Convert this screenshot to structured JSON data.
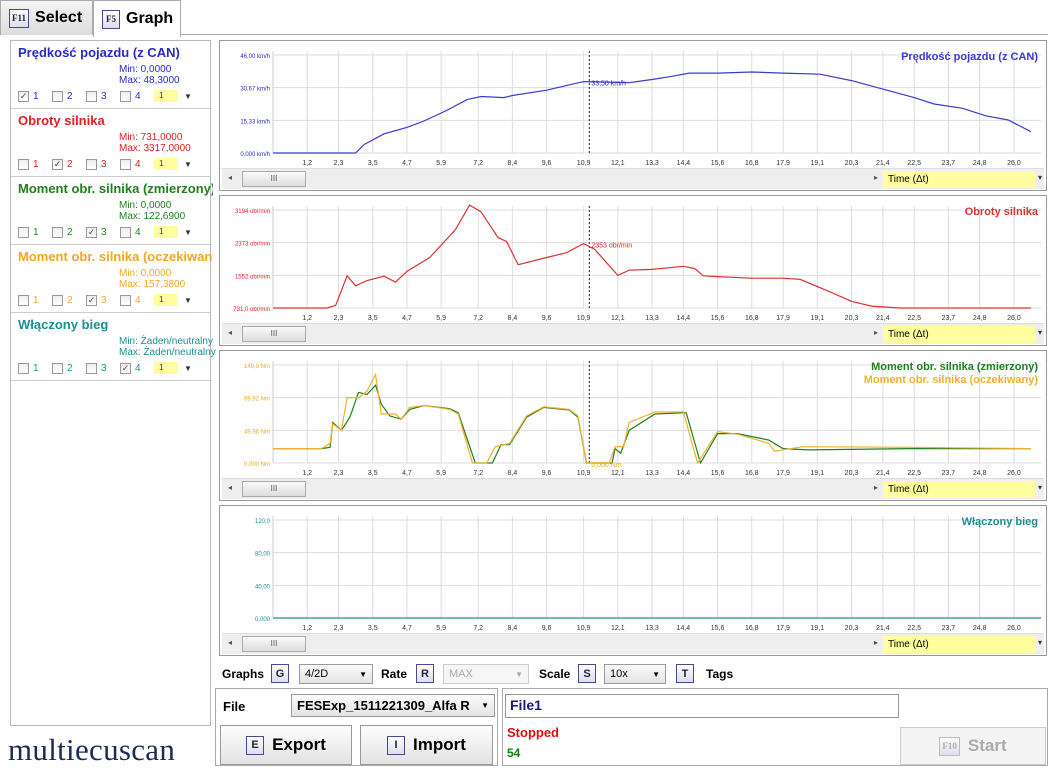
{
  "tabs": [
    {
      "key": "F11",
      "label": "Select"
    },
    {
      "key": "F5",
      "label": "Graph"
    }
  ],
  "parameters": [
    {
      "title": "Prędkość pojazdu (z CAN)",
      "min": "Min: 0,0000",
      "max": "Max: 48,3000",
      "color": "#2a2ac8",
      "checked": 1,
      "scale": "1"
    },
    {
      "title": "Obroty silnika",
      "min": "Min: 731,0000",
      "max": "Max: 3317,0000",
      "color": "#e02020",
      "checked": 2,
      "scale": "1"
    },
    {
      "title": "Moment obr. silnika (zmierzony)",
      "min": "Min: 0,0000",
      "max": "Max: 122,6900",
      "color": "#208020",
      "checked": 3,
      "scale": "1"
    },
    {
      "title": "Moment obr. silnika (oczekiwany)",
      "min": "Min: 0,0000",
      "max": "Max: 157,3800",
      "color": "#f0a820",
      "checked": 3,
      "scale": "1"
    },
    {
      "title": "Włączony bieg",
      "min": "Min: Żaden/neutralny",
      "max": "Max: Żaden/neutralny",
      "color": "#1a9090",
      "checked": 4,
      "scale": "1"
    }
  ],
  "checkbox_labels": [
    "1",
    "2",
    "3",
    "4"
  ],
  "logo": "multiecuscan",
  "axis": {
    "label": "Time (Δt)",
    "scroll_thumb": "III",
    "ticks": [
      1.2,
      2.3,
      3.5,
      4.7,
      5.9,
      7.2,
      8.4,
      9.6,
      10.9,
      12.1,
      13.3,
      14.4,
      15.6,
      16.8,
      17.9,
      19.1,
      20.3,
      21.4,
      22.5,
      23.7,
      24.8,
      26.0
    ],
    "tick_labels": [
      "1,2",
      "2,3",
      "3,5",
      "4,7",
      "5,9",
      "7,2",
      "8,4",
      "9,6",
      "10,9",
      "12,1",
      "13,3",
      "14,4",
      "15,6",
      "16,8",
      "17,9",
      "19,1",
      "20,3",
      "21,4",
      "22,5",
      "23,7",
      "24,8",
      "26,0"
    ],
    "xlim": [
      0,
      26.95
    ],
    "cursor_t": 11.1
  },
  "chart_data": [
    {
      "type": "line",
      "ylim": [
        0,
        46
      ],
      "ytick_labels": [
        "46,00 km/h",
        "30,67 km/h",
        "15,33 km/h",
        "0,000 km/h"
      ],
      "yticks": [
        46,
        30.67,
        15.33,
        0
      ],
      "cursor_label": "33,50 km/h",
      "cursor_color": "#2a2ac8",
      "series": [
        {
          "name": "Prędkość pojazdu (z CAN)",
          "color": "#3a3ad0",
          "points": [
            [
              0,
              0
            ],
            [
              2.9,
              0
            ],
            [
              3.2,
              4
            ],
            [
              3.9,
              9
            ],
            [
              4.7,
              12
            ],
            [
              5.3,
              15
            ],
            [
              6.1,
              20
            ],
            [
              6.8,
              25
            ],
            [
              7.3,
              26.5
            ],
            [
              8.1,
              26
            ],
            [
              8.4,
              27
            ],
            [
              9.6,
              29.5
            ],
            [
              10.9,
              33.5
            ],
            [
              11.8,
              33.3
            ],
            [
              12.5,
              33
            ],
            [
              13.3,
              34.5
            ],
            [
              14,
              36
            ],
            [
              14.6,
              37.5
            ],
            [
              15.6,
              37.5
            ],
            [
              16.8,
              38
            ],
            [
              17.9,
              37.5
            ],
            [
              19.2,
              37
            ],
            [
              20.3,
              34
            ],
            [
              21.4,
              30
            ],
            [
              22.5,
              26
            ],
            [
              23.2,
              23
            ],
            [
              24.2,
              21
            ],
            [
              25,
              17.5
            ],
            [
              25.8,
              15.5
            ],
            [
              26.6,
              10
            ]
          ]
        }
      ]
    },
    {
      "type": "line",
      "ylim": [
        731,
        3194
      ],
      "ytick_labels": [
        "3194 obr/min",
        "2373 obr/min",
        "1552 obr/min",
        "731,0 obr/min"
      ],
      "yticks": [
        3194,
        2373,
        1552,
        731
      ],
      "cursor_label": "2353 obr/min",
      "cursor_color": "#e02020",
      "series": [
        {
          "name": "Obroty silnika",
          "color": "#e03030",
          "points": [
            [
              0,
              731
            ],
            [
              1.9,
              731
            ],
            [
              2.2,
              800
            ],
            [
              2.6,
              1540
            ],
            [
              2.9,
              1290
            ],
            [
              3.3,
              1420
            ],
            [
              3.9,
              1530
            ],
            [
              4.3,
              1380
            ],
            [
              4.7,
              1650
            ],
            [
              5.5,
              2000
            ],
            [
              6.4,
              2700
            ],
            [
              6.9,
              3317
            ],
            [
              7.3,
              3150
            ],
            [
              7.9,
              2500
            ],
            [
              8.2,
              2400
            ],
            [
              8.6,
              1820
            ],
            [
              9.6,
              2000
            ],
            [
              10.3,
              2120
            ],
            [
              10.9,
              2353
            ],
            [
              11.3,
              2200
            ],
            [
              12.1,
              1550
            ],
            [
              12.5,
              1680
            ],
            [
              13.3,
              1700
            ],
            [
              14.4,
              1780
            ],
            [
              14.8,
              1720
            ],
            [
              15.1,
              1540
            ],
            [
              15.6,
              1520
            ],
            [
              16.8,
              1480
            ],
            [
              17.9,
              1480
            ],
            [
              18.5,
              1450
            ],
            [
              19.5,
              1150
            ],
            [
              20.3,
              900
            ],
            [
              21,
              780
            ],
            [
              22,
              731
            ],
            [
              26.6,
              731
            ]
          ]
        }
      ]
    },
    {
      "type": "line",
      "ylim": [
        0,
        149.9
      ],
      "ytick_labels": [
        "149,9 Nm",
        "99,92 Nm",
        "49,96 Nm",
        "0,000 Nm"
      ],
      "yticks": [
        149.9,
        99.92,
        49.96,
        0
      ],
      "cursor_label": "0,000 Nm",
      "cursor_color": "#f0a820",
      "series": [
        {
          "name": "Moment obr. silnika (zmierzony)",
          "color": "#208020",
          "points": [
            [
              0,
              22
            ],
            [
              1.7,
              22
            ],
            [
              2.0,
              24
            ],
            [
              2.1,
              62
            ],
            [
              2.4,
              50
            ],
            [
              2.7,
              70
            ],
            [
              3.0,
              108
            ],
            [
              3.3,
              105
            ],
            [
              3.6,
              119
            ],
            [
              3.8,
              90
            ],
            [
              4.1,
              72
            ],
            [
              4.5,
              67
            ],
            [
              4.8,
              82
            ],
            [
              5.3,
              88
            ],
            [
              6.2,
              83
            ],
            [
              6.5,
              77
            ],
            [
              7.1,
              0
            ],
            [
              7.7,
              0
            ],
            [
              8.0,
              28
            ],
            [
              8.3,
              28
            ],
            [
              8.9,
              70
            ],
            [
              9.5,
              85
            ],
            [
              10.4,
              81
            ],
            [
              10.7,
              70
            ],
            [
              11.0,
              0
            ],
            [
              11.9,
              0
            ],
            [
              12.0,
              22
            ],
            [
              12.2,
              15
            ],
            [
              12.5,
              50
            ],
            [
              13.4,
              75
            ],
            [
              14.5,
              77
            ],
            [
              15.0,
              0
            ],
            [
              15.6,
              45
            ],
            [
              16.3,
              45
            ],
            [
              17.4,
              35
            ],
            [
              17.9,
              22
            ],
            [
              18.8,
              20
            ],
            [
              22.3,
              22
            ],
            [
              26.6,
              22
            ]
          ]
        },
        {
          "name": "Moment obr. silnika (oczekiwany)",
          "color": "#f0b030",
          "points": [
            [
              0,
              22
            ],
            [
              1.7,
              22
            ],
            [
              2.0,
              30
            ],
            [
              2.1,
              60
            ],
            [
              2.4,
              50
            ],
            [
              2.6,
              100
            ],
            [
              3.0,
              100
            ],
            [
              3.3,
              110
            ],
            [
              3.6,
              135
            ],
            [
              3.8,
              75
            ],
            [
              4.3,
              75
            ],
            [
              4.5,
              67
            ],
            [
              4.8,
              85
            ],
            [
              5.3,
              88
            ],
            [
              6.2,
              82
            ],
            [
              6.5,
              75
            ],
            [
              7.0,
              0
            ],
            [
              7.5,
              0
            ],
            [
              7.8,
              25
            ],
            [
              8.3,
              30
            ],
            [
              8.9,
              72
            ],
            [
              9.5,
              86
            ],
            [
              10.4,
              82
            ],
            [
              10.7,
              72
            ],
            [
              11.0,
              0
            ],
            [
              11.8,
              0
            ],
            [
              12.0,
              25
            ],
            [
              12.3,
              25
            ],
            [
              12.5,
              62
            ],
            [
              13.4,
              78
            ],
            [
              14.4,
              78
            ],
            [
              14.9,
              0
            ],
            [
              15.6,
              48
            ],
            [
              16.3,
              44
            ],
            [
              17.4,
              30
            ],
            [
              17.6,
              18
            ],
            [
              18.6,
              25
            ],
            [
              22.3,
              24
            ],
            [
              26.6,
              22
            ]
          ]
        }
      ]
    },
    {
      "type": "line",
      "ylim": [
        0,
        120
      ],
      "ytick_labels": [
        "120,0",
        "80,00",
        "40,00",
        "0,000"
      ],
      "yticks": [
        120,
        80,
        40,
        0
      ],
      "cursor_label": "",
      "cursor_color": "#1a9090",
      "series": [
        {
          "name": "Włączony bieg",
          "color": "#1a9090",
          "points": [
            [
              0,
              0
            ],
            [
              26.95,
              0
            ]
          ]
        }
      ]
    }
  ],
  "toolbar": {
    "graphs_label": "Graphs",
    "graphs_key": "G",
    "graphs_value": "4/2D",
    "rate_label": "Rate",
    "rate_key": "R",
    "rate_value": "MAX",
    "scale_label": "Scale",
    "scale_key": "S",
    "scale_value": "10x",
    "tags_key": "T",
    "tags_label": "Tags"
  },
  "file": {
    "label": "File",
    "value": "FESExp_1511221309_Alfa R",
    "export_key": "E",
    "export_label": "Export",
    "import_key": "I",
    "import_label": "Import"
  },
  "status": {
    "name": "File1",
    "state": "Stopped",
    "count": "54",
    "start_key": "F10",
    "start_label": "Start"
  }
}
